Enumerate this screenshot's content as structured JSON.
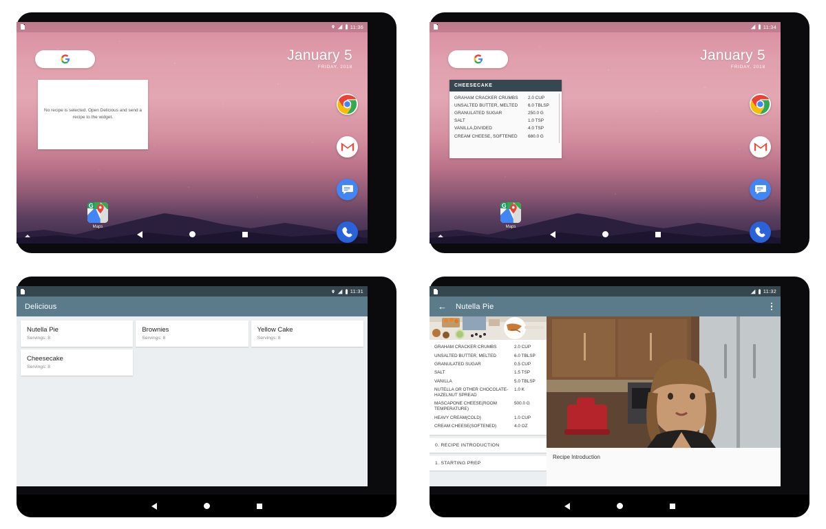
{
  "colors": {
    "appbar": "#5b7b8a",
    "widget_header": "#37474f",
    "statusbar_dark": "#35464e",
    "page_bg": "#eceff1"
  },
  "tablet_home_empty": {
    "statusbar": {
      "sim_icon": "sim-icon",
      "location_icon": "location-pin-icon",
      "signal_icon": "signal-icon",
      "battery_icon": "battery-icon",
      "time": "11:36"
    },
    "search_widget": {
      "logo": "google-g-logo"
    },
    "clock": {
      "date": "January 5",
      "sub": "FRIDAY, 2018"
    },
    "widget": {
      "message": "No recipe is selected. Open Delicious and send a recipe to the widget."
    },
    "shortcut": {
      "label": "Maps",
      "icon": "google-maps-icon"
    },
    "dock": [
      {
        "name": "chrome-icon",
        "label": "Chrome"
      },
      {
        "name": "gmail-icon",
        "label": "Gmail"
      },
      {
        "name": "messages-icon",
        "label": "Messages"
      },
      {
        "name": "phone-icon",
        "label": "Phone"
      }
    ],
    "navbar": {
      "back": "back-icon",
      "home": "home-icon",
      "recents": "recents-icon"
    }
  },
  "tablet_home_recipe": {
    "statusbar": {
      "signal_icon": "signal-icon",
      "battery_icon": "battery-icon",
      "time": "11:34"
    },
    "clock": {
      "date": "January 5",
      "sub": "FRIDAY, 2018"
    },
    "widget": {
      "title": "CHEESECAKE",
      "ingredients": [
        {
          "name": "GRAHAM CRACKER CRUMBS",
          "qty": "2.0 CUP"
        },
        {
          "name": "UNSALTED BUTTER, MELTED",
          "qty": "6.0 TBLSP"
        },
        {
          "name": "GRANULATED SUGAR",
          "qty": "250.0 G"
        },
        {
          "name": "SALT",
          "qty": "1.0 TSP"
        },
        {
          "name": "VANILLA,DIVIDED",
          "qty": "4.0 TSP"
        },
        {
          "name": "CREAM CHEESE, SOFTENED",
          "qty": "680.0 G"
        }
      ]
    },
    "shortcut": {
      "label": "Maps"
    }
  },
  "tablet_list": {
    "statusbar": {
      "time": "11:31"
    },
    "appbar": {
      "title": "Delicious"
    },
    "recipes": [
      {
        "title": "Nutella Pie",
        "servings": "Servings:  8"
      },
      {
        "title": "Brownies",
        "servings": "Servings:  8"
      },
      {
        "title": "Yellow Cake",
        "servings": "Servings:  8"
      },
      {
        "title": "Cheesecake",
        "servings": "Servings:  8"
      }
    ]
  },
  "tablet_detail": {
    "statusbar": {
      "time": "11:32"
    },
    "appbar": {
      "back": "back-arrow-icon",
      "title": "Nutella Pie",
      "overflow": "overflow-menu-icon"
    },
    "ingredients": [
      {
        "name": "GRAHAM CRACKER CRUMBS",
        "qty": "2.0 CUP"
      },
      {
        "name": "UNSALTED BUTTER, MELTED",
        "qty": "6.0 TBLSP"
      },
      {
        "name": "GRANULATED SUGAR",
        "qty": "0.5 CUP"
      },
      {
        "name": "SALT",
        "qty": "1.5 TSP"
      },
      {
        "name": "VANILLA",
        "qty": "5.0 TBLSP"
      },
      {
        "name": "NUTELLA OR OTHER CHOCOLATE-HAZELNUT SPREAD",
        "qty": "1.0 K"
      },
      {
        "name": "MASCAPONE CHEESE(ROOM TEMPERATURE)",
        "qty": "500.0 G"
      },
      {
        "name": "HEAVY CREAM(COLD)",
        "qty": "1.0 CUP"
      },
      {
        "name": "CREAM CHEESE(SOFTENED)",
        "qty": "4.0 OZ"
      }
    ],
    "steps": [
      {
        "label": "0. RECIPE INTRODUCTION"
      },
      {
        "label": "1. STARTING PREP"
      }
    ],
    "video_caption": "Recipe Introduction"
  }
}
